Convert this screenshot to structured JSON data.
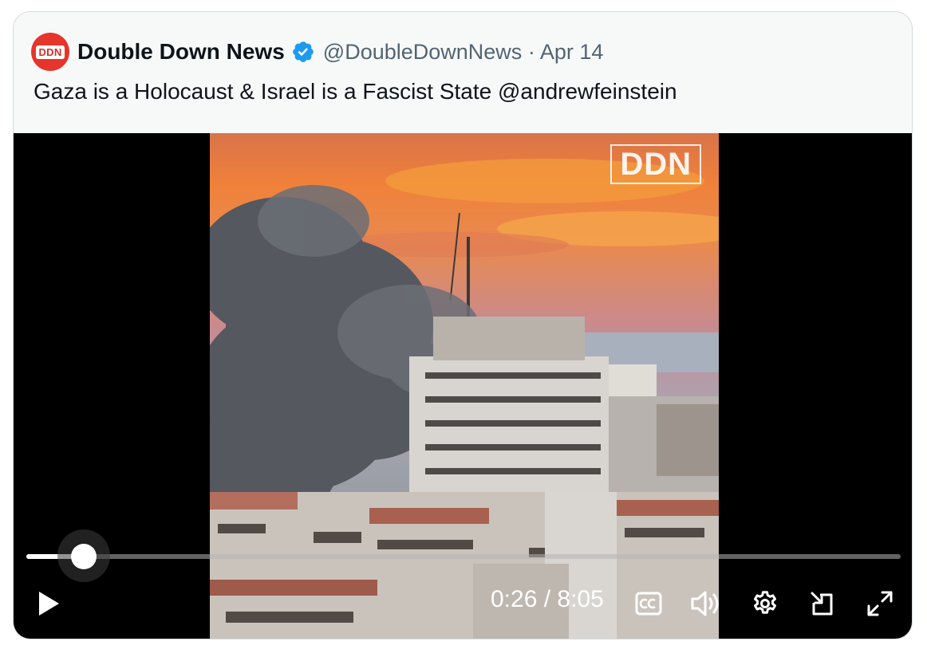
{
  "author": {
    "avatar_text": "DDN",
    "name": "Double Down News",
    "handle": "@DoubleDownNews",
    "separator": "·",
    "date": "Apr 14",
    "verified": true
  },
  "tweet": {
    "text": "Gaza is a Holocaust & Israel is a Fascist State @andrewfeinstein"
  },
  "video": {
    "watermark": "DDN",
    "current_time": "0:26",
    "time_separator": "/",
    "duration": "8:05",
    "progress": 0.066
  },
  "controls": {
    "play": "play-icon",
    "captions": "cc-icon",
    "volume": "volume-icon",
    "settings": "gear-icon",
    "pop_out": "pop-out-icon",
    "fullscreen": "fullscreen-icon"
  },
  "colors": {
    "avatar_bg": "#e8352b",
    "verified_blue": "#1d9bf0",
    "text_primary": "#0f1419",
    "text_secondary": "#536471"
  }
}
